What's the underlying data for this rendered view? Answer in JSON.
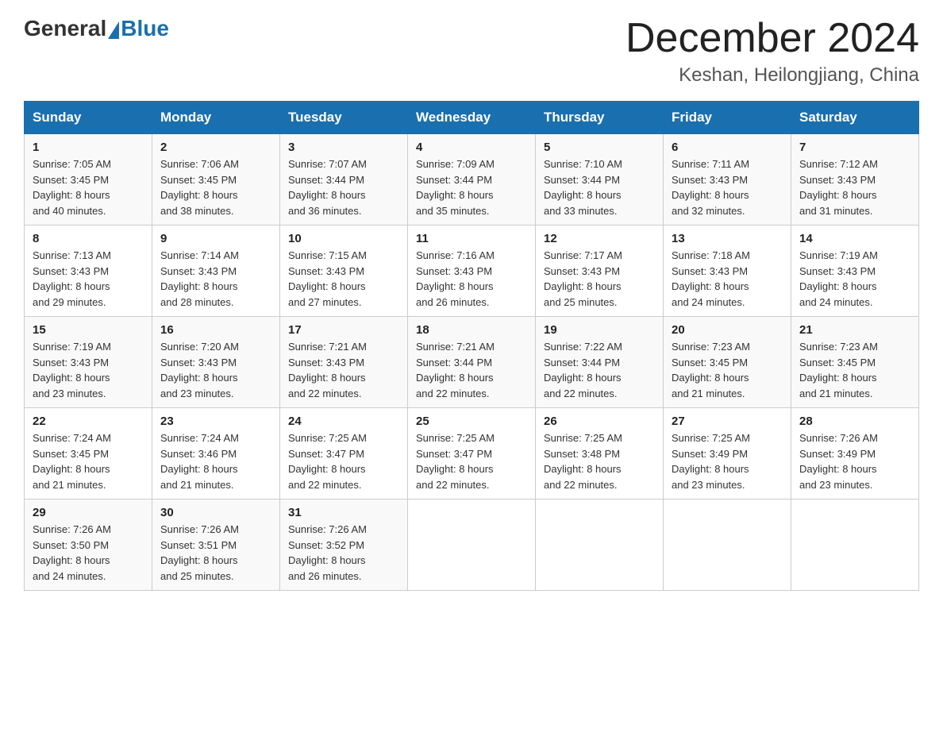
{
  "header": {
    "logo_general": "General",
    "logo_blue": "Blue",
    "month_title": "December 2024",
    "location": "Keshan, Heilongjiang, China"
  },
  "days_of_week": [
    "Sunday",
    "Monday",
    "Tuesday",
    "Wednesday",
    "Thursday",
    "Friday",
    "Saturday"
  ],
  "weeks": [
    [
      {
        "day": "1",
        "sunrise": "7:05 AM",
        "sunset": "3:45 PM",
        "daylight": "8 hours and 40 minutes."
      },
      {
        "day": "2",
        "sunrise": "7:06 AM",
        "sunset": "3:45 PM",
        "daylight": "8 hours and 38 minutes."
      },
      {
        "day": "3",
        "sunrise": "7:07 AM",
        "sunset": "3:44 PM",
        "daylight": "8 hours and 36 minutes."
      },
      {
        "day": "4",
        "sunrise": "7:09 AM",
        "sunset": "3:44 PM",
        "daylight": "8 hours and 35 minutes."
      },
      {
        "day": "5",
        "sunrise": "7:10 AM",
        "sunset": "3:44 PM",
        "daylight": "8 hours and 33 minutes."
      },
      {
        "day": "6",
        "sunrise": "7:11 AM",
        "sunset": "3:43 PM",
        "daylight": "8 hours and 32 minutes."
      },
      {
        "day": "7",
        "sunrise": "7:12 AM",
        "sunset": "3:43 PM",
        "daylight": "8 hours and 31 minutes."
      }
    ],
    [
      {
        "day": "8",
        "sunrise": "7:13 AM",
        "sunset": "3:43 PM",
        "daylight": "8 hours and 29 minutes."
      },
      {
        "day": "9",
        "sunrise": "7:14 AM",
        "sunset": "3:43 PM",
        "daylight": "8 hours and 28 minutes."
      },
      {
        "day": "10",
        "sunrise": "7:15 AM",
        "sunset": "3:43 PM",
        "daylight": "8 hours and 27 minutes."
      },
      {
        "day": "11",
        "sunrise": "7:16 AM",
        "sunset": "3:43 PM",
        "daylight": "8 hours and 26 minutes."
      },
      {
        "day": "12",
        "sunrise": "7:17 AM",
        "sunset": "3:43 PM",
        "daylight": "8 hours and 25 minutes."
      },
      {
        "day": "13",
        "sunrise": "7:18 AM",
        "sunset": "3:43 PM",
        "daylight": "8 hours and 24 minutes."
      },
      {
        "day": "14",
        "sunrise": "7:19 AM",
        "sunset": "3:43 PM",
        "daylight": "8 hours and 24 minutes."
      }
    ],
    [
      {
        "day": "15",
        "sunrise": "7:19 AM",
        "sunset": "3:43 PM",
        "daylight": "8 hours and 23 minutes."
      },
      {
        "day": "16",
        "sunrise": "7:20 AM",
        "sunset": "3:43 PM",
        "daylight": "8 hours and 23 minutes."
      },
      {
        "day": "17",
        "sunrise": "7:21 AM",
        "sunset": "3:43 PM",
        "daylight": "8 hours and 22 minutes."
      },
      {
        "day": "18",
        "sunrise": "7:21 AM",
        "sunset": "3:44 PM",
        "daylight": "8 hours and 22 minutes."
      },
      {
        "day": "19",
        "sunrise": "7:22 AM",
        "sunset": "3:44 PM",
        "daylight": "8 hours and 22 minutes."
      },
      {
        "day": "20",
        "sunrise": "7:23 AM",
        "sunset": "3:45 PM",
        "daylight": "8 hours and 21 minutes."
      },
      {
        "day": "21",
        "sunrise": "7:23 AM",
        "sunset": "3:45 PM",
        "daylight": "8 hours and 21 minutes."
      }
    ],
    [
      {
        "day": "22",
        "sunrise": "7:24 AM",
        "sunset": "3:45 PM",
        "daylight": "8 hours and 21 minutes."
      },
      {
        "day": "23",
        "sunrise": "7:24 AM",
        "sunset": "3:46 PM",
        "daylight": "8 hours and 21 minutes."
      },
      {
        "day": "24",
        "sunrise": "7:25 AM",
        "sunset": "3:47 PM",
        "daylight": "8 hours and 22 minutes."
      },
      {
        "day": "25",
        "sunrise": "7:25 AM",
        "sunset": "3:47 PM",
        "daylight": "8 hours and 22 minutes."
      },
      {
        "day": "26",
        "sunrise": "7:25 AM",
        "sunset": "3:48 PM",
        "daylight": "8 hours and 22 minutes."
      },
      {
        "day": "27",
        "sunrise": "7:25 AM",
        "sunset": "3:49 PM",
        "daylight": "8 hours and 23 minutes."
      },
      {
        "day": "28",
        "sunrise": "7:26 AM",
        "sunset": "3:49 PM",
        "daylight": "8 hours and 23 minutes."
      }
    ],
    [
      {
        "day": "29",
        "sunrise": "7:26 AM",
        "sunset": "3:50 PM",
        "daylight": "8 hours and 24 minutes."
      },
      {
        "day": "30",
        "sunrise": "7:26 AM",
        "sunset": "3:51 PM",
        "daylight": "8 hours and 25 minutes."
      },
      {
        "day": "31",
        "sunrise": "7:26 AM",
        "sunset": "3:52 PM",
        "daylight": "8 hours and 26 minutes."
      },
      null,
      null,
      null,
      null
    ]
  ],
  "labels": {
    "sunrise": "Sunrise: ",
    "sunset": "Sunset: ",
    "daylight": "Daylight: "
  }
}
